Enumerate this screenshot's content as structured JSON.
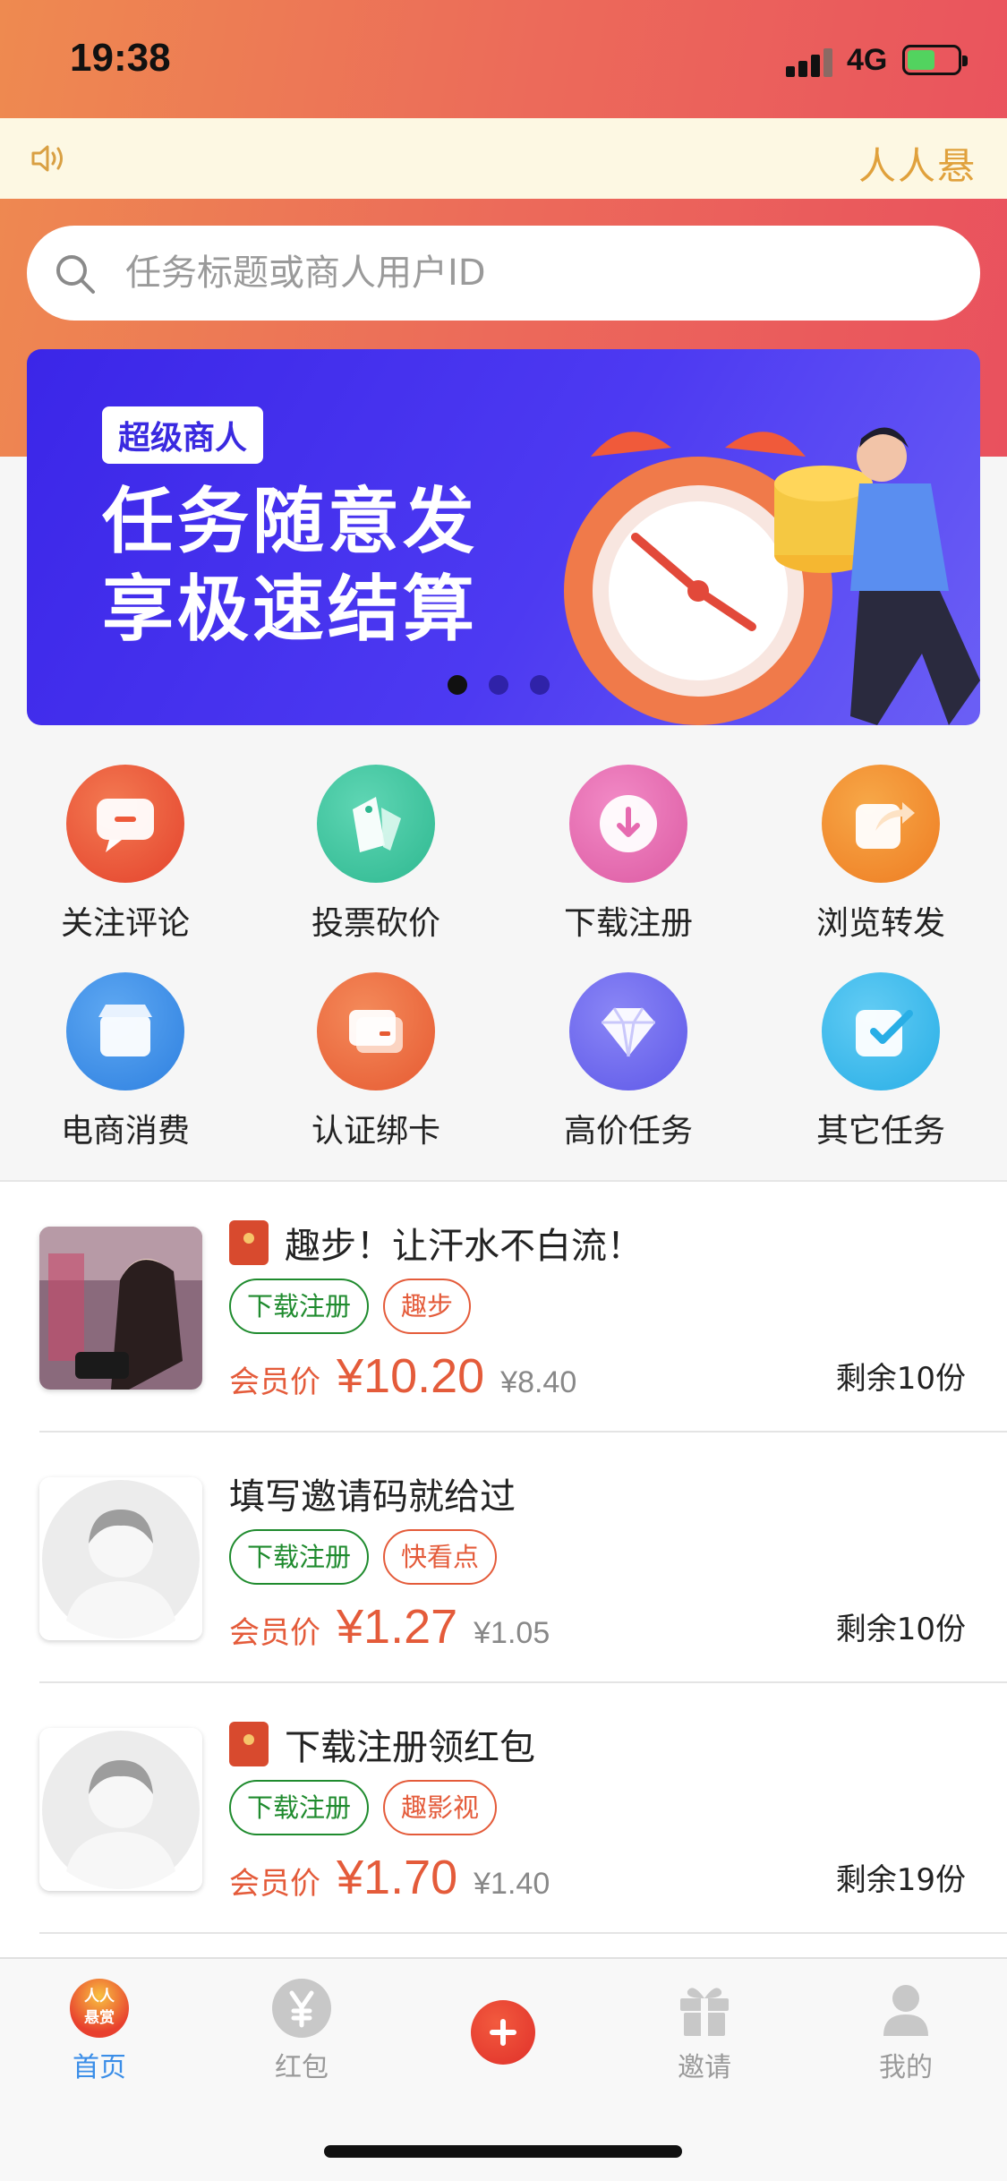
{
  "status_bar": {
    "time": "19:38",
    "network": "4G"
  },
  "notice": {
    "brand": "人人悬"
  },
  "search": {
    "placeholder": "任务标题或商人用户ID"
  },
  "banner": {
    "badge": "超级商人",
    "line1": "任务随意发",
    "line2": "享极速结算",
    "active_dot": 0,
    "dot_count": 3
  },
  "categories": [
    {
      "label": "关注评论",
      "icon": "comment-icon",
      "color": "#ec5537"
    },
    {
      "label": "投票砍价",
      "icon": "price-tag-icon",
      "color": "#3cc4a0"
    },
    {
      "label": "下载注册",
      "icon": "download-icon",
      "color": "#e66ab0"
    },
    {
      "label": "浏览转发",
      "icon": "share-icon",
      "color": "#f28a2a"
    },
    {
      "label": "电商消费",
      "icon": "shop-icon",
      "color": "#3b8ee8"
    },
    {
      "label": "认证绑卡",
      "icon": "card-icon",
      "color": "#ee6a3e"
    },
    {
      "label": "高价任务",
      "icon": "diamond-icon",
      "color": "#6f6cf0"
    },
    {
      "label": "其它任务",
      "icon": "check-icon",
      "color": "#38b8ee"
    }
  ],
  "tasks": [
    {
      "title": "趣步！让汗水不白流！",
      "has_redpack": true,
      "tags": [
        "下载注册",
        "趣步"
      ],
      "member_label": "会员价",
      "price": "¥10.20",
      "original": "¥8.40",
      "remaining": "剩余10份"
    },
    {
      "title": "填写邀请码就给过",
      "has_redpack": false,
      "tags": [
        "下载注册",
        "快看点"
      ],
      "member_label": "会员价",
      "price": "¥1.27",
      "original": "¥1.05",
      "remaining": "剩余10份"
    },
    {
      "title": "下载注册领红包",
      "has_redpack": true,
      "tags": [
        "下载注册",
        "趣影视"
      ],
      "member_label": "会员价",
      "price": "¥1.70",
      "original": "¥1.40",
      "remaining": "剩余19份"
    }
  ],
  "tabbar": [
    {
      "label": "首页",
      "icon": "home-logo-icon",
      "active": true,
      "logo_text": "人人悬赏"
    },
    {
      "label": "红包",
      "icon": "yuan-icon",
      "active": false
    },
    {
      "label": "",
      "icon": "add-icon",
      "active": false
    },
    {
      "label": "邀请",
      "icon": "gift-icon",
      "active": false
    },
    {
      "label": "我的",
      "icon": "user-icon",
      "active": false
    }
  ],
  "colors": {
    "accent": "#e45b3a",
    "tag_green": "#1f8b2e",
    "tab_active": "#3b8ee8",
    "banner": "#4d3af2"
  }
}
